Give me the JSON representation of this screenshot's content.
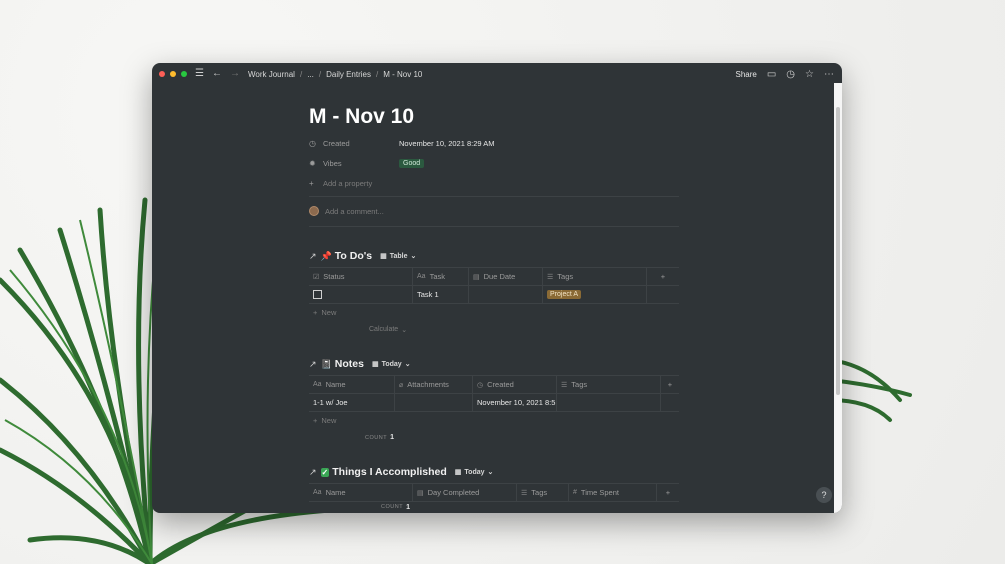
{
  "breadcrumbs": [
    "Work Journal",
    "...",
    "Daily Entries",
    "M - Nov 10"
  ],
  "titlebar": {
    "share_label": "Share"
  },
  "page": {
    "title": "M - Nov 10",
    "properties": [
      {
        "icon": "clock-icon",
        "name": "Created",
        "value": "November 10, 2021 8:29 AM"
      },
      {
        "icon": "gear-icon",
        "name": "Vibes",
        "value": "Good",
        "type": "tag",
        "tag_color": "#2b593f"
      }
    ],
    "add_property_label": "Add a property",
    "comment_placeholder": "Add a comment..."
  },
  "todos": {
    "title": "To Do's",
    "emoji": "📌",
    "view": "Table",
    "headers": [
      "Status",
      "Task",
      "Due Date",
      "Tags"
    ],
    "rows": [
      {
        "status": "",
        "task": "Task 1",
        "due": "",
        "tag": "Project A"
      }
    ],
    "new_label": "New",
    "calculate_label": "Calculate"
  },
  "notes": {
    "title": "Notes",
    "emoji": "📓",
    "view": "Today",
    "headers": [
      "Name",
      "Attachments",
      "Created",
      "Tags"
    ],
    "rows": [
      {
        "name": "1-1 w/ Joe",
        "attachments": "",
        "created": "November 10, 2021 8:5",
        "tags": ""
      }
    ],
    "new_label": "New",
    "count_label": "COUNT",
    "count_value": "1"
  },
  "accomplished": {
    "title": "Things I Accomplished",
    "emoji": "✅",
    "view": "Today",
    "headers": [
      "Name",
      "Day Completed",
      "Tags",
      "Time Spent"
    ],
    "count_label": "COUNT",
    "count_value": "1"
  },
  "help_label": "?"
}
